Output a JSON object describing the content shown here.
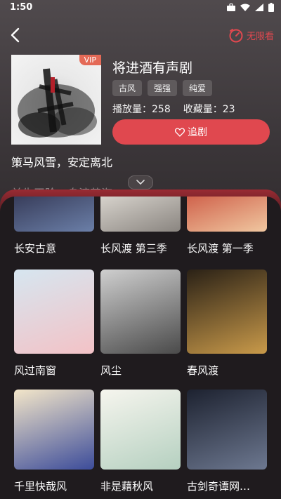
{
  "status_bar": {
    "time": "1:50"
  },
  "header": {
    "unlimited_label": "无限看"
  },
  "drama": {
    "vip_badge": "VIP",
    "title": "将进酒有声剧",
    "tags": [
      "古风",
      "强强",
      "纯爱"
    ],
    "play_count_label": "播放量：258",
    "favorite_count_label": "收藏量：23",
    "follow_label": "追剧",
    "description_line1": "策马风雪，安定离北",
    "description_line2": "兰生玉阶，舟渡苦海"
  },
  "colors": {
    "accent": "#e0484f",
    "vip": "#e46a57"
  },
  "recommendations": [
    {
      "name": "长安古意",
      "colors": [
        "#2d2f4a",
        "#6b7fa8"
      ]
    },
    {
      "name": "长风渡 第三季",
      "colors": [
        "#e7e3dc",
        "#8a8580"
      ]
    },
    {
      "name": "长风渡  第一季",
      "colors": [
        "#c94d3a",
        "#f0c7a0"
      ]
    },
    {
      "name": "风过南窗",
      "colors": [
        "#d6e6f0",
        "#f3c2c6"
      ]
    },
    {
      "name": "风尘",
      "colors": [
        "#cfcfcf",
        "#4a4a4a"
      ]
    },
    {
      "name": "春风渡",
      "colors": [
        "#2a2116",
        "#c99a4a"
      ]
    },
    {
      "name": "千里快哉风",
      "colors": [
        "#f3e6c9",
        "#3c4c9a"
      ]
    },
    {
      "name": "非是藉秋风",
      "colors": [
        "#f6f5ee",
        "#b5d0c0"
      ]
    },
    {
      "name": "古剑奇谭网…",
      "colors": [
        "#1d2230",
        "#6d7890"
      ]
    }
  ]
}
